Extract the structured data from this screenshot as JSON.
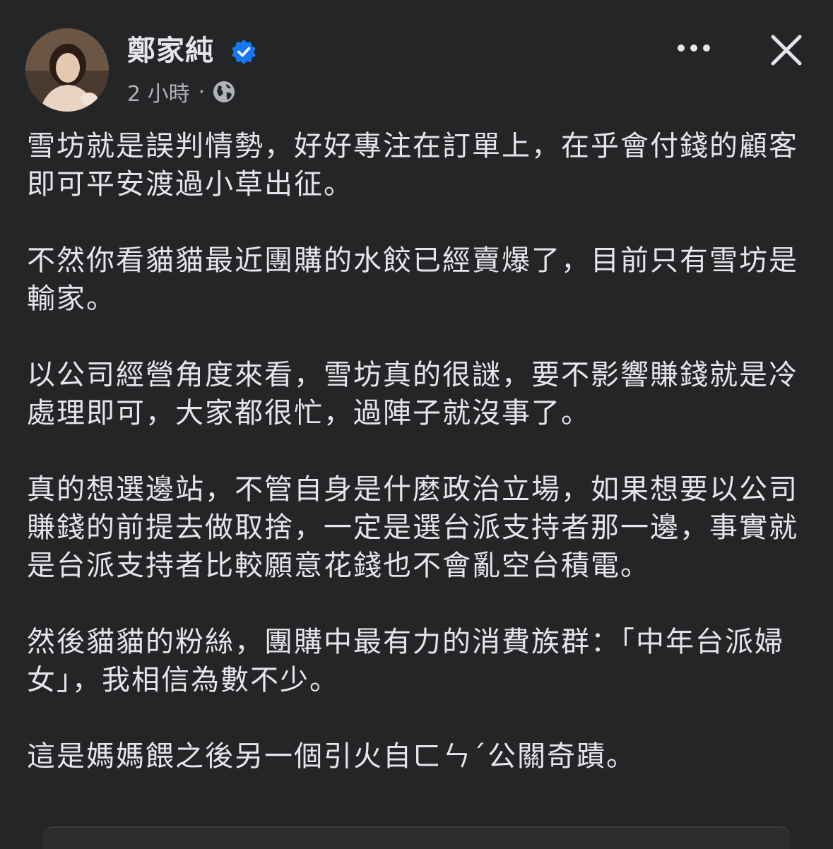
{
  "post": {
    "author": "鄭家純",
    "verified": true,
    "time": "2 小時",
    "separator": "·",
    "audience_icon": "globe-icon",
    "more_icon": "more-horizontal-icon",
    "close_icon": "close-icon",
    "paragraphs": [
      "雪坊就是誤判情勢，好好專注在訂單上，在乎會付錢的顧客即可平安渡過小草出征。",
      "不然你看貓貓最近團購的水餃已經賣爆了，目前只有雪坊是輸家。",
      "以公司經營角度來看，雪坊真的很謎，要不影響賺錢就是冷處理即可，大家都很忙，過陣子就沒事了。",
      "真的想選邊站，不管自身是什麼政治立場，如果想要以公司賺錢的前提去做取捨，一定是選台派支持者那一邊，事實就是台派支持者比較願意花錢也不會亂空台積電。",
      "然後貓貓的粉絲，團購中最有力的消費族群：「中年台派婦女」，我相信為數不少。",
      "這是媽媽餵之後另一個引火自ㄈㄣˊ公關奇蹟。"
    ]
  },
  "colors": {
    "background": "#242526",
    "text": "#e4e6eb",
    "secondary_text": "#b0b3b8",
    "verified_badge": "#1877f2"
  }
}
